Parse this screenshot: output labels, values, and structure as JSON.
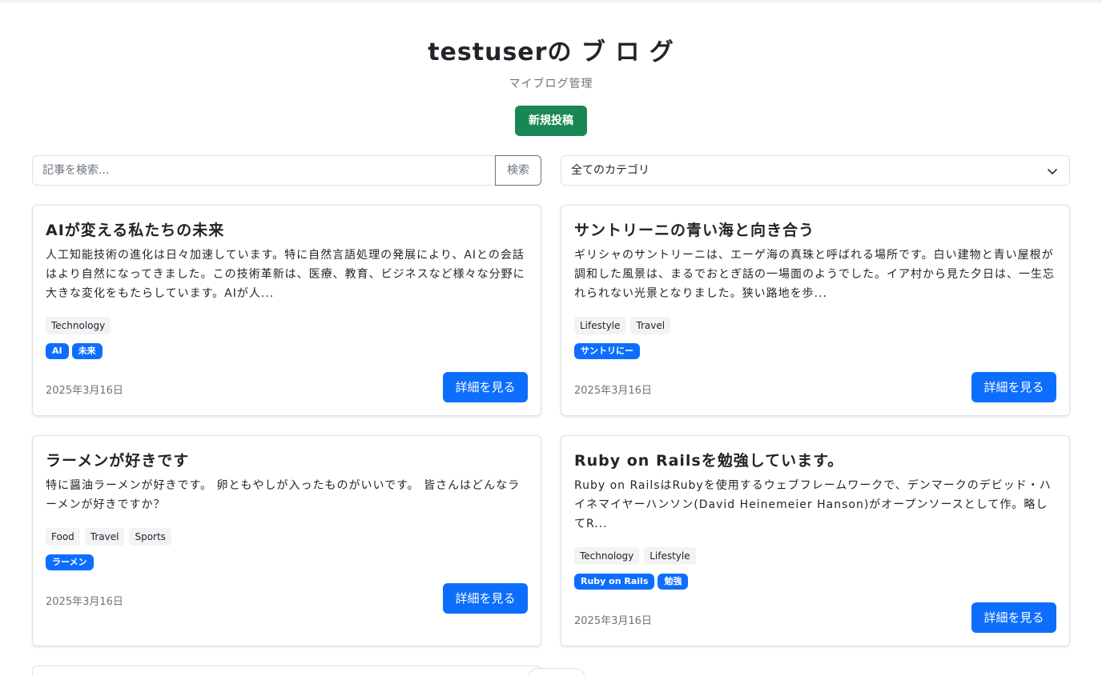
{
  "header": {
    "title": "testuserの ブ ロ グ",
    "subtitle": "マイブログ管理",
    "new_post_label": "新規投稿"
  },
  "search": {
    "placeholder": "記事を検索...",
    "button_label": "検索"
  },
  "category_filter": {
    "selected": "全てのカテゴリ"
  },
  "colors": {
    "primary": "#0d6efd",
    "success": "#198754",
    "muted": "#6c757d",
    "border": "#dee2e6"
  },
  "posts": [
    {
      "title": "AIが変える私たちの未来",
      "excerpt": "人工知能技術の進化は日々加速しています。特に自然言語処理の発展により、AIとの会話はより自然になってきました。この技術革新は、医療、教育、ビジネスなど様々な分野に大きな変化をもたらしています。AIが人...",
      "categories": [
        "Technology"
      ],
      "tags": [
        "AI",
        "未来"
      ],
      "date": "2025年3月16日",
      "button": "詳細を見る"
    },
    {
      "title": "サントリーニの青い海と向き合う",
      "excerpt": "ギリシャのサントリーニは、エーゲ海の真珠と呼ばれる場所です。白い建物と青い屋根が調和した風景は、まるでおとぎ話の一場面のようでした。イア村から見た夕日は、一生忘れられない光景となりました。狭い路地を歩...",
      "categories": [
        "Lifestyle",
        "Travel"
      ],
      "tags": [
        "サントリにー"
      ],
      "date": "2025年3月16日",
      "button": "詳細を見る"
    },
    {
      "title": "ラーメンが好きです",
      "excerpt": "特に醤油ラーメンが好きです。 卵ともやしが入ったものがいいです。 皆さんはどんなラーメンが好きですか？",
      "categories": [
        "Food",
        "Travel",
        "Sports"
      ],
      "tags": [
        "ラーメン"
      ],
      "date": "2025年3月16日",
      "button": "詳細を見る"
    },
    {
      "title": "Ruby on Railsを勉強しています。",
      "excerpt": "Ruby on RailsはRubyを使用するウェブフレームワークで、デンマークのデビッド・ハイネマイヤーハンソン(David Heinemeier Hanson)がオープンソースとして作。略してR...",
      "categories": [
        "Technology",
        "Lifestyle"
      ],
      "tags": [
        "Ruby on Rails",
        "勉強"
      ],
      "date": "2025年3月16日",
      "button": "詳細を見る"
    }
  ]
}
